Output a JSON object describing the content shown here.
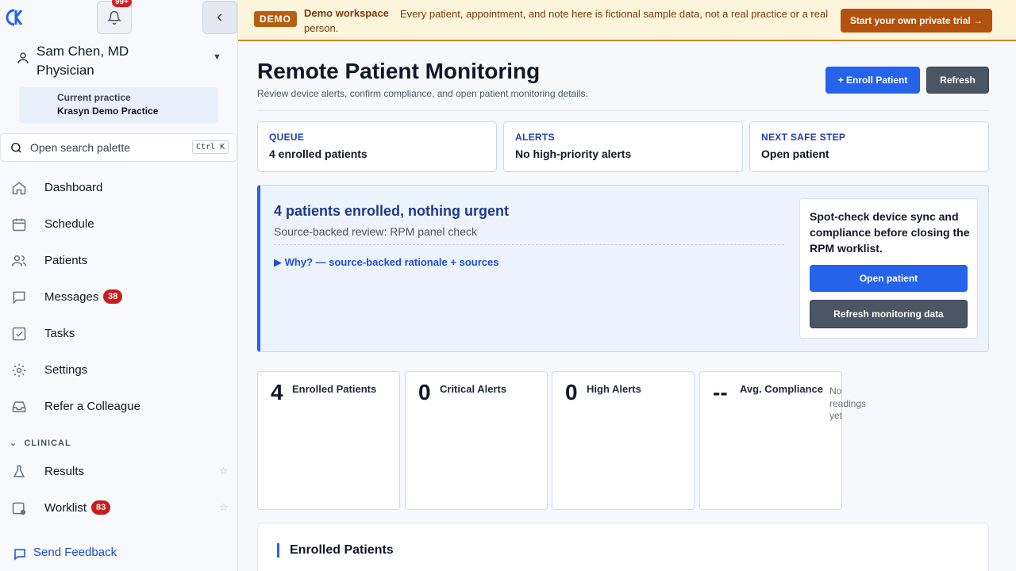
{
  "sidebar": {
    "notification_badge": "99+",
    "user": {
      "name": "Sam Chen, MD",
      "role": "Physician"
    },
    "practice": {
      "label": "Current practice",
      "name": "Krasyn Demo Practice"
    },
    "search": {
      "placeholder": "Open search palette",
      "shortcut": "Ctrl K"
    },
    "nav": [
      {
        "label": "Dashboard",
        "icon": "home-icon"
      },
      {
        "label": "Schedule",
        "icon": "calendar-icon"
      },
      {
        "label": "Patients",
        "icon": "users-icon"
      },
      {
        "label": "Messages",
        "icon": "message-icon",
        "badge": "38"
      },
      {
        "label": "Tasks",
        "icon": "checkbox-icon"
      },
      {
        "label": "Settings",
        "icon": "gear-icon"
      },
      {
        "label": "Refer a Colleague",
        "icon": "inbox-icon"
      }
    ],
    "section": "CLINICAL",
    "clinical": [
      {
        "label": "Results",
        "icon": "flask-icon"
      },
      {
        "label": "Worklist",
        "icon": "worklist-icon",
        "badge": "83"
      }
    ],
    "feedback": "Send Feedback"
  },
  "banner": {
    "tag": "DEMO",
    "title": "Demo workspace",
    "text": "Every patient, appointment, and note here is fictional sample data, not a real practice or a real person.",
    "cta": "Start your own private trial →"
  },
  "page": {
    "title": "Remote Patient Monitoring",
    "subtitle": "Review device alerts, confirm compliance, and open patient monitoring details.",
    "enroll_label": "+ Enroll Patient",
    "refresh_label": "Refresh"
  },
  "status_cards": [
    {
      "kicker": "QUEUE",
      "value": "4 enrolled patients"
    },
    {
      "kicker": "ALERTS",
      "value": "No high-priority alerts"
    },
    {
      "kicker": "NEXT SAFE STEP",
      "value": "Open patient"
    }
  ],
  "focus": {
    "title": "4 patients enrolled, nothing urgent",
    "subtitle": "Source-backed review: RPM panel check",
    "why": "▶  Why? — source-backed rationale + sources",
    "next_text": "Spot-check device sync and compliance before closing the RPM worklist.",
    "open_label": "Open patient",
    "refresh_label": "Refresh monitoring data"
  },
  "stats": [
    {
      "value": "4",
      "label": "Enrolled Patients"
    },
    {
      "value": "0",
      "label": "Critical Alerts"
    },
    {
      "value": "0",
      "label": "High Alerts"
    },
    {
      "value": "--",
      "label": "Avg. Compliance",
      "note": "No readings yet"
    }
  ],
  "enrolled_section": {
    "title": "Enrolled Patients"
  },
  "colors": {
    "accent": "#2563eb",
    "danger": "#c81e1e",
    "demo": "#b55f12"
  }
}
